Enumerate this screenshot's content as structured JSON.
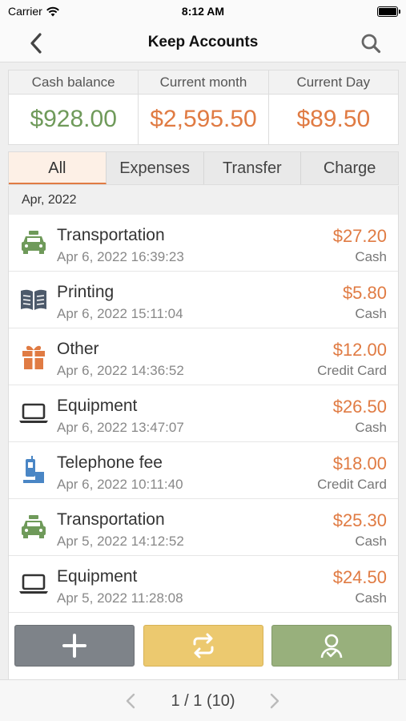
{
  "status_bar": {
    "carrier": "Carrier",
    "time": "8:12 AM"
  },
  "nav": {
    "title": "Keep Accounts",
    "back_icon": "chevron-left-icon",
    "search_icon": "search-icon"
  },
  "summary": [
    {
      "label": "Cash balance",
      "value": "$928.00",
      "color": "#6f9a5a"
    },
    {
      "label": "Current month",
      "value": "$2,595.50",
      "color": "#e07b43"
    },
    {
      "label": "Current Day",
      "value": "$89.50",
      "color": "#e07b43"
    }
  ],
  "tabs": [
    {
      "label": "All",
      "active": true
    },
    {
      "label": "Expenses",
      "active": false
    },
    {
      "label": "Transfer",
      "active": false
    },
    {
      "label": "Charge",
      "active": false
    }
  ],
  "section": {
    "month": "Apr, 2022"
  },
  "transactions": [
    {
      "title": "Transportation",
      "date": "Apr 6, 2022 16:39:23",
      "amount": "$27.20",
      "method": "Cash",
      "icon": "taxi-icon"
    },
    {
      "title": "Printing",
      "date": "Apr 6, 2022 15:11:04",
      "amount": "$5.80",
      "method": "Cash",
      "icon": "book-icon"
    },
    {
      "title": "Other",
      "date": "Apr 6, 2022 14:36:52",
      "amount": "$12.00",
      "method": "Credit Card",
      "icon": "gift-icon"
    },
    {
      "title": "Equipment",
      "date": "Apr 6, 2022 13:47:07",
      "amount": "$26.50",
      "method": "Cash",
      "icon": "laptop-icon"
    },
    {
      "title": "Telephone fee",
      "date": "Apr 6, 2022 10:11:40",
      "amount": "$18.00",
      "method": "Credit Card",
      "icon": "phone-icon"
    },
    {
      "title": "Transportation",
      "date": "Apr 5, 2022 14:12:52",
      "amount": "$25.30",
      "method": "Cash",
      "icon": "taxi-icon"
    },
    {
      "title": "Equipment",
      "date": "Apr 5, 2022 11:28:08",
      "amount": "$24.50",
      "method": "Cash",
      "icon": "laptop-icon"
    }
  ],
  "actions": {
    "add_icon": "plus-icon",
    "transfer_icon": "repeat-icon",
    "person_icon": "person-icon"
  },
  "pagination": {
    "label": "1 / 1 (10)"
  }
}
